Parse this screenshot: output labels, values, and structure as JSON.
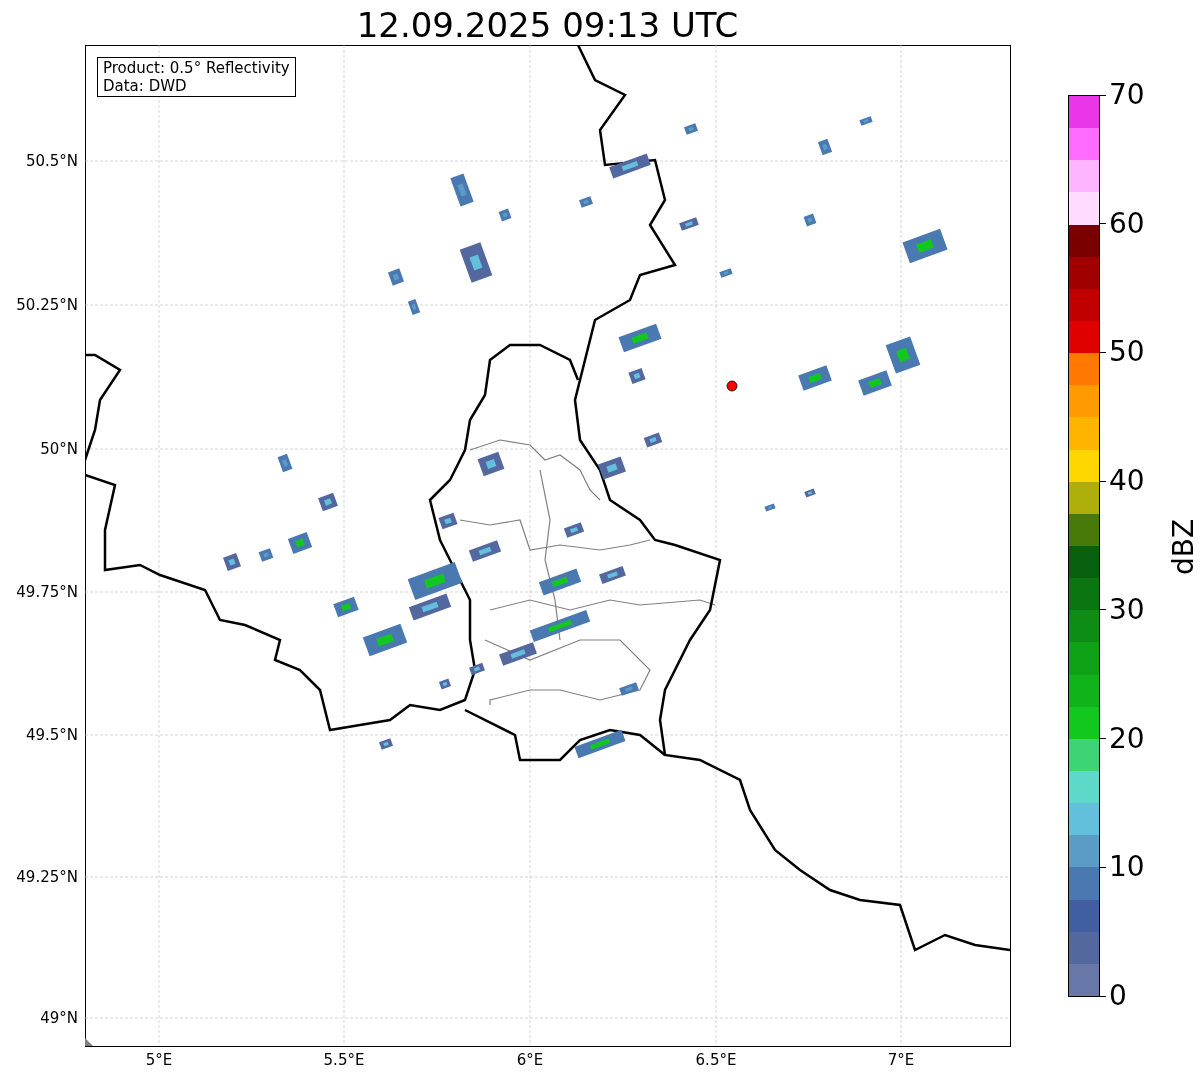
{
  "title": "12.09.2025 09:13 UTC",
  "info_box": [
    "Product: 0.5° Reflectivity",
    "Data: DWD"
  ],
  "map": {
    "lat_ticks": [
      "50.5°N",
      "50.25°N",
      "50°N",
      "49.75°N",
      "49.5°N",
      "49.25°N",
      "49°N"
    ],
    "lon_ticks": [
      "5°E",
      "5.5°E",
      "6°E",
      "6.5°E",
      "7°E"
    ]
  },
  "colorbar": {
    "label": "dBZ",
    "ticks": [
      "70",
      "60",
      "50",
      "40",
      "30",
      "20",
      "10",
      "0"
    ],
    "segments": [
      {
        "color": "#6677a8"
      },
      {
        "color": "#5468a0"
      },
      {
        "color": "#405ea0"
      },
      {
        "color": "#4a78b0"
      },
      {
        "color": "#5a9cc6"
      },
      {
        "color": "#62c0dc"
      },
      {
        "color": "#5ed8c8"
      },
      {
        "color": "#3dd476"
      },
      {
        "color": "#12c81e"
      },
      {
        "color": "#10b41a"
      },
      {
        "color": "#0fa216"
      },
      {
        "color": "#0e8c16"
      },
      {
        "color": "#0b7512"
      },
      {
        "color": "#07600e"
      },
      {
        "color": "#487a0a"
      },
      {
        "color": "#aeae0a"
      },
      {
        "color": "#ffd700"
      },
      {
        "color": "#ffb400"
      },
      {
        "color": "#ff9a00"
      },
      {
        "color": "#ff7800"
      },
      {
        "color": "#e00000"
      },
      {
        "color": "#c00000"
      },
      {
        "color": "#a00000"
      },
      {
        "color": "#7a0000"
      },
      {
        "color": "#ffdcff"
      },
      {
        "color": "#ffb4ff"
      },
      {
        "color": "#ff6cff"
      },
      {
        "color": "#e836e8"
      }
    ]
  }
}
